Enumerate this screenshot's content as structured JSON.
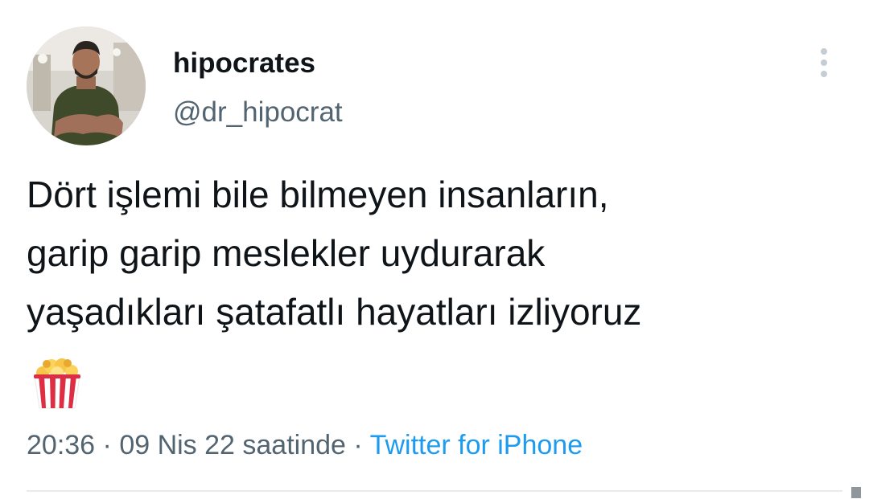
{
  "tweet": {
    "author": {
      "display_name": "hipocrates",
      "handle": "@dr_hipocrat",
      "avatar_icon": "profile-photo"
    },
    "more_icon": "more-vertical-icon",
    "text_lines": [
      "Dört işlemi bile bilmeyen insanların,",
      "garip garip meslekler uydurarak",
      "yaşadıkları şatafatlı hayatları izliyoruz"
    ],
    "emoji": "popcorn-icon",
    "meta": {
      "time": "20:36",
      "separator": " · ",
      "date": "09 Nis 22 saatinde",
      "source": "Twitter for iPhone"
    }
  },
  "colors": {
    "text_primary": "#0f1419",
    "text_secondary": "#536471",
    "link": "#1d9bf0",
    "divider": "#e7ebee"
  }
}
